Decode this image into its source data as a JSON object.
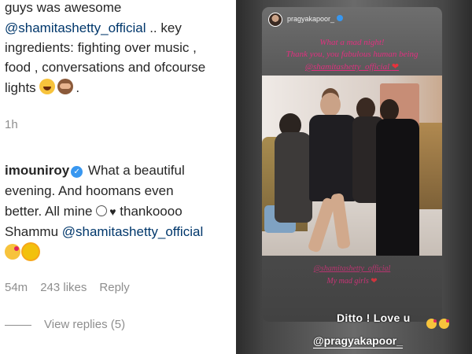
{
  "comment1": {
    "line1": "guys was awesome",
    "mention": "@shamitashetty_official",
    "line2_rest": " .. key",
    "line3": "ingredients: fighting over music ,",
    "line4": "food , conversations and ofcourse",
    "line5": "lights",
    "line5_end": ".",
    "emojis": [
      "laughing-face",
      "see-no-evil-monkey"
    ],
    "time": "1h"
  },
  "comment2": {
    "username": "imouniroy",
    "text1": " What a beautiful",
    "text2": "evening. And hoomans even",
    "text3": "better. All mine ",
    "text3_end": " thankoooo",
    "text4_start": "Shammu ",
    "mention": "@shamitashetty_official",
    "emojis": [
      "smiling-face",
      "black-heart",
      "kissing-heart-face",
      "sun-face"
    ],
    "time": "54m",
    "likes": "243 likes",
    "reply": "Reply",
    "view_replies": "View replies (5)"
  },
  "story": {
    "username": "pragyakapoor_",
    "line1": "What a mad night!",
    "line2": "Thank you, you fabulous human being",
    "line3": "@shamitashetty_official",
    "line4": "@shamitashetty_official",
    "line5": "My mad girls",
    "reply_text": "Ditto ! Love u",
    "reply_tag": "@pragyakapoor_",
    "colors": {
      "text": "#e0307f",
      "heart": "#e8323c",
      "mention": "#00376b",
      "verified": "#3897f0"
    }
  }
}
